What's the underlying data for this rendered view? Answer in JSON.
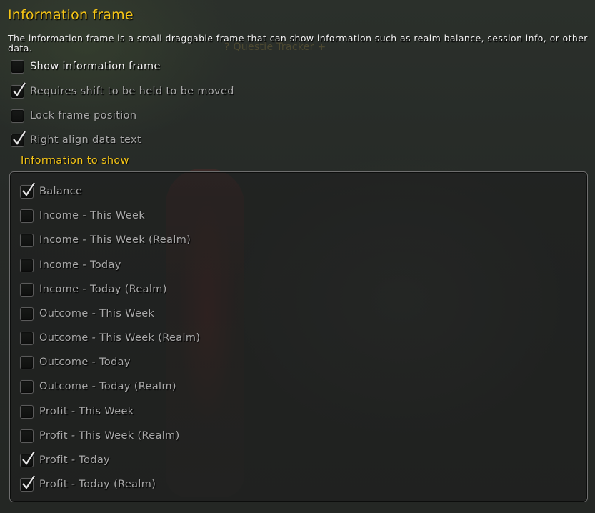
{
  "header": {
    "title": "Information frame",
    "description": "The information frame is a small draggable frame that can show information such as realm balance, session info, or other data."
  },
  "background": {
    "watermark": "? Questie Tracker +"
  },
  "options": [
    {
      "label": "Show information frame",
      "checked": false
    },
    {
      "label": "Requires shift to be held to be moved",
      "checked": true
    },
    {
      "label": "Lock frame position",
      "checked": false
    },
    {
      "label": "Right align data text",
      "checked": true
    }
  ],
  "info_section": {
    "label": "Information to show",
    "items": [
      {
        "label": "Balance",
        "checked": true
      },
      {
        "label": "Income - This Week",
        "checked": false
      },
      {
        "label": "Income - This Week (Realm)",
        "checked": false
      },
      {
        "label": "Income - Today",
        "checked": false
      },
      {
        "label": "Income - Today (Realm)",
        "checked": false
      },
      {
        "label": "Outcome - This Week",
        "checked": false
      },
      {
        "label": "Outcome - This Week (Realm)",
        "checked": false
      },
      {
        "label": "Outcome - Today",
        "checked": false
      },
      {
        "label": "Outcome - Today (Realm)",
        "checked": false
      },
      {
        "label": "Profit - This Week",
        "checked": false
      },
      {
        "label": "Profit - This Week (Realm)",
        "checked": false
      },
      {
        "label": "Profit - Today",
        "checked": true
      },
      {
        "label": "Profit - Today (Realm)",
        "checked": true
      }
    ]
  },
  "colors": {
    "title": "#f5c517",
    "text": "#f0f0f0",
    "muted_text": "#a9a9a9"
  }
}
